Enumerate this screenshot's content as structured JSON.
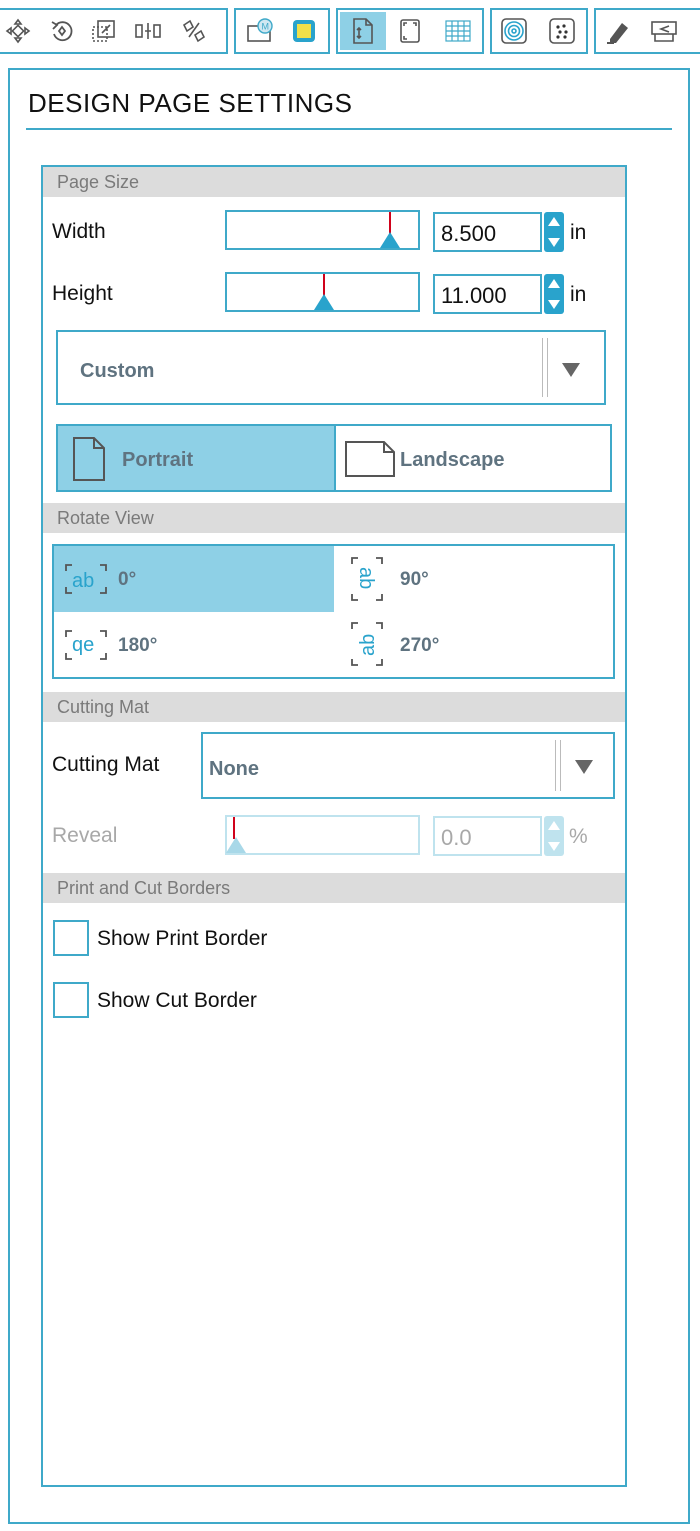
{
  "toolbar": {
    "icons": [
      "move-icon",
      "rotate-icon",
      "scale-icon",
      "align-icon",
      "replicate-icon",
      "library-icon",
      "fill-icon",
      "page-setup-icon",
      "registration-icon",
      "grid-icon",
      "offset-icon",
      "trace-icon",
      "sketch-icon",
      "send-icon"
    ]
  },
  "panel": {
    "title": "DESIGN PAGE SETTINGS"
  },
  "page_size": {
    "header": "Page Size",
    "width_label": "Width",
    "width_value": "8.500",
    "width_unit": "in",
    "height_label": "Height",
    "height_value": "11.000",
    "height_unit": "in",
    "preset_value": "Custom",
    "portrait_label": "Portrait",
    "landscape_label": "Landscape",
    "selected_orientation": "Portrait"
  },
  "rotate_view": {
    "header": "Rotate View",
    "options": [
      {
        "label": "0°",
        "glyph": "ab"
      },
      {
        "label": "90°",
        "glyph": "ab"
      },
      {
        "label": "180°",
        "glyph": "qe"
      },
      {
        "label": "270°",
        "glyph": "ab"
      }
    ],
    "selected": "0°"
  },
  "cutting_mat": {
    "header": "Cutting Mat",
    "label": "Cutting Mat",
    "value": "None",
    "reveal_label": "Reveal",
    "reveal_value": "0.0",
    "reveal_unit": "%"
  },
  "borders": {
    "header": "Print and Cut Borders",
    "show_print_border": "Show Print Border",
    "show_cut_border": "Show Cut Border",
    "print_border_checked": false,
    "cut_border_checked": false
  },
  "colors": {
    "accent": "#3fa9c9",
    "selected_bg": "#8ed0e6",
    "spinner": "#29a3cc",
    "indicator": "#d0021b"
  }
}
